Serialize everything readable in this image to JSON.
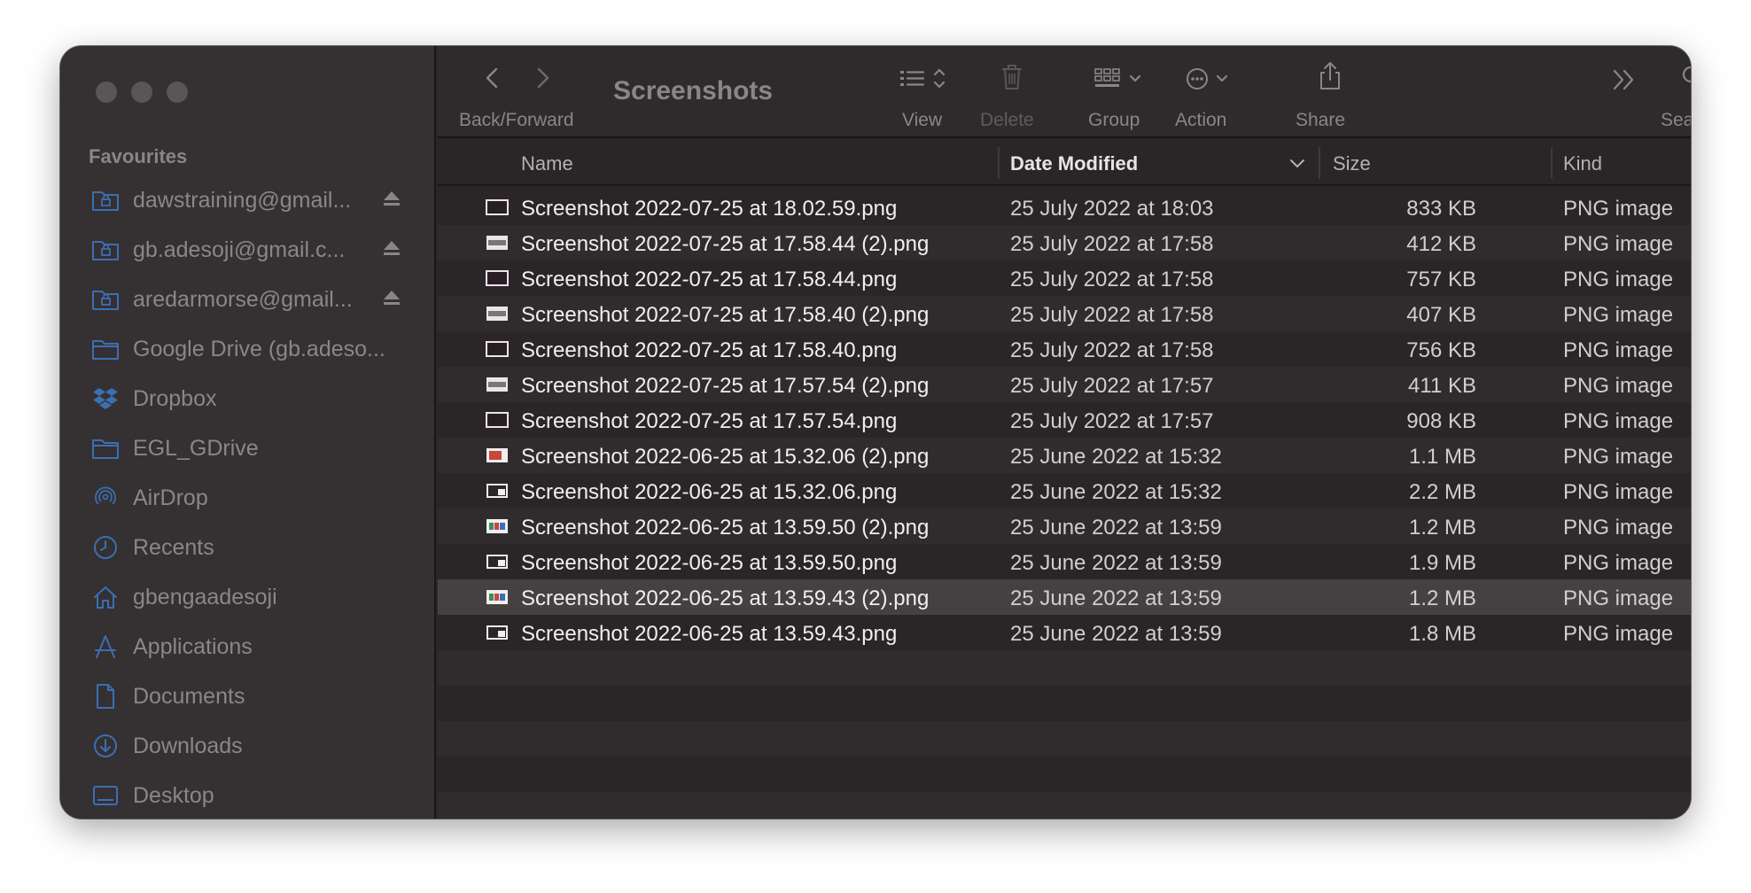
{
  "window": {
    "title": "Screenshots"
  },
  "toolbar": {
    "back_forward_label": "Back/Forward",
    "view_label": "View",
    "delete_label": "Delete",
    "group_label": "Group",
    "action_label": "Action",
    "share_label": "Share",
    "search_label": "Search"
  },
  "sidebar": {
    "section_title": "Favourites",
    "items": [
      {
        "label": "dawstraining@gmail...",
        "icon": "cloud-folder-icon",
        "eject": true
      },
      {
        "label": "gb.adesoji@gmail.c...",
        "icon": "cloud-folder-icon",
        "eject": true
      },
      {
        "label": "aredarmorse@gmail...",
        "icon": "cloud-folder-icon",
        "eject": true
      },
      {
        "label": "Google Drive (gb.adeso...",
        "icon": "folder-icon",
        "eject": false
      },
      {
        "label": "Dropbox",
        "icon": "dropbox-icon",
        "eject": false
      },
      {
        "label": "EGL_GDrive",
        "icon": "folder-icon",
        "eject": false
      },
      {
        "label": "AirDrop",
        "icon": "airdrop-icon",
        "eject": false
      },
      {
        "label": "Recents",
        "icon": "clock-icon",
        "eject": false
      },
      {
        "label": "gbengaadesoji",
        "icon": "home-icon",
        "eject": false
      },
      {
        "label": "Applications",
        "icon": "applications-icon",
        "eject": false
      },
      {
        "label": "Documents",
        "icon": "document-icon",
        "eject": false
      },
      {
        "label": "Downloads",
        "icon": "download-icon",
        "eject": false
      },
      {
        "label": "Desktop",
        "icon": "desktop-icon",
        "eject": false
      }
    ]
  },
  "columns": {
    "name": "Name",
    "date_modified": "Date Modified",
    "size": "Size",
    "kind": "Kind"
  },
  "files": [
    {
      "name": "Screenshot 2022-07-25 at 18.02.59.png",
      "date": "25 July 2022 at 18:03",
      "size": "833 KB",
      "kind": "PNG image",
      "thumb": "dark"
    },
    {
      "name": "Screenshot 2022-07-25 at 17.58.44 (2).png",
      "date": "25 July 2022 at 17:58",
      "size": "412 KB",
      "kind": "PNG image",
      "thumb": "light"
    },
    {
      "name": "Screenshot 2022-07-25 at 17.58.44.png",
      "date": "25 July 2022 at 17:58",
      "size": "757 KB",
      "kind": "PNG image",
      "thumb": "dark"
    },
    {
      "name": "Screenshot 2022-07-25 at 17.58.40 (2).png",
      "date": "25 July 2022 at 17:58",
      "size": "407 KB",
      "kind": "PNG image",
      "thumb": "light"
    },
    {
      "name": "Screenshot 2022-07-25 at 17.58.40.png",
      "date": "25 July 2022 at 17:58",
      "size": "756 KB",
      "kind": "PNG image",
      "thumb": "dark"
    },
    {
      "name": "Screenshot 2022-07-25 at 17.57.54 (2).png",
      "date": "25 July 2022 at 17:57",
      "size": "411 KB",
      "kind": "PNG image",
      "thumb": "light"
    },
    {
      "name": "Screenshot 2022-07-25 at 17.57.54.png",
      "date": "25 July 2022 at 17:57",
      "size": "908 KB",
      "kind": "PNG image",
      "thumb": "dark"
    },
    {
      "name": "Screenshot 2022-06-25 at 15.32.06 (2).png",
      "date": "25 June 2022 at 15:32",
      "size": "1.1 MB",
      "kind": "PNG image",
      "thumb": "red"
    },
    {
      "name": "Screenshot 2022-06-25 at 15.32.06.png",
      "date": "25 June 2022 at 15:32",
      "size": "2.2 MB",
      "kind": "PNG image",
      "thumb": "window"
    },
    {
      "name": "Screenshot 2022-06-25 at 13.59.50 (2).png",
      "date": "25 June 2022 at 13:59",
      "size": "1.2 MB",
      "kind": "PNG image",
      "thumb": "color"
    },
    {
      "name": "Screenshot 2022-06-25 at 13.59.50.png",
      "date": "25 June 2022 at 13:59",
      "size": "1.9 MB",
      "kind": "PNG image",
      "thumb": "window"
    },
    {
      "name": "Screenshot 2022-06-25 at 13.59.43 (2).png",
      "date": "25 June 2022 at 13:59",
      "size": "1.2 MB",
      "kind": "PNG image",
      "thumb": "color",
      "selected": true
    },
    {
      "name": "Screenshot 2022-06-25 at 13.59.43.png",
      "date": "25 June 2022 at 13:59",
      "size": "1.8 MB",
      "kind": "PNG image",
      "thumb": "window"
    }
  ],
  "colors": {
    "window_bg": "#2a2627",
    "sidebar_bg": "#353032",
    "sidebar_icon": "#3b6fb3",
    "selected_row": "#454143"
  }
}
